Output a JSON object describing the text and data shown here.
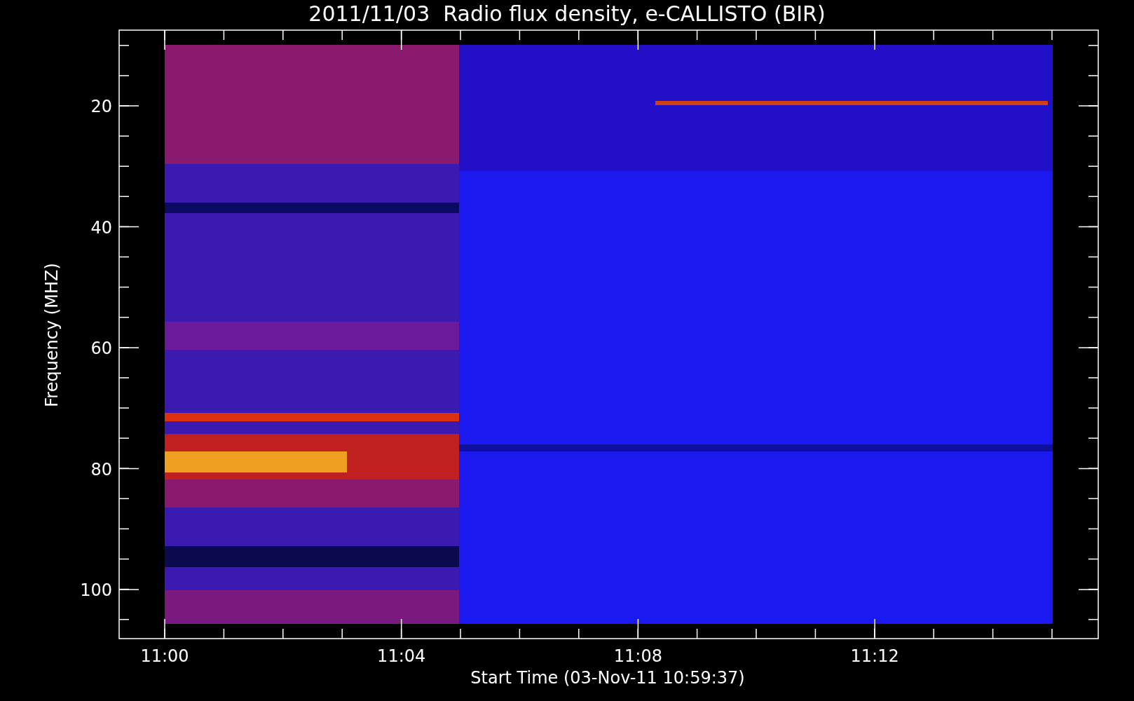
{
  "title": "2011/11/03  Radio flux density, e-CALLISTO (BIR)",
  "y_axis": {
    "label": "Frequency (MHZ)",
    "ticks": [
      "20",
      "40",
      "60",
      "80",
      "100"
    ]
  },
  "x_axis": {
    "label": "Start Time (03-Nov-11 10:59:37)",
    "ticks": [
      "11:00",
      "11:04",
      "11:08",
      "11:12"
    ]
  }
}
